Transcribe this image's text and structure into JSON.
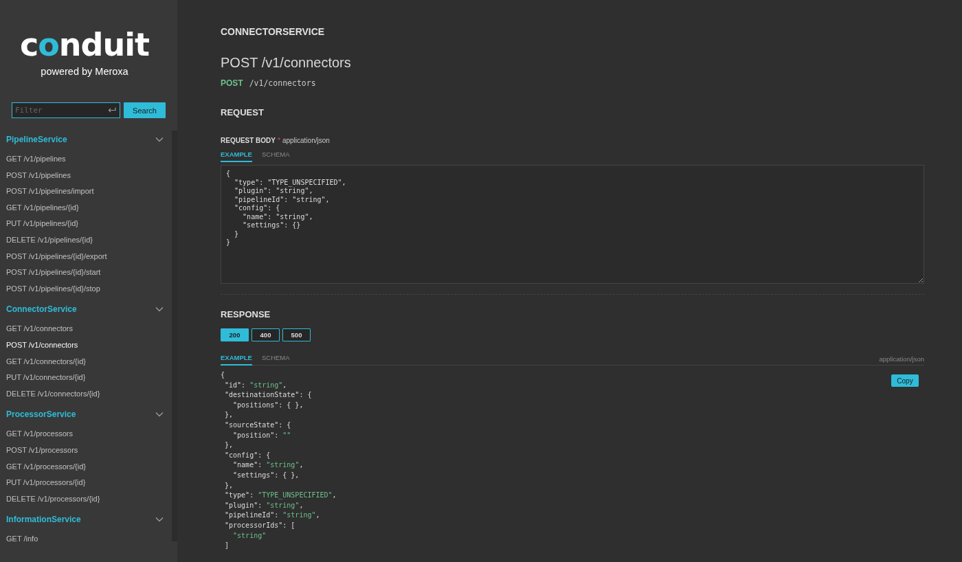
{
  "sidebar": {
    "logo": "conduit",
    "tagline": "powered by Meroxa",
    "filter": {
      "placeholder": "Filter"
    },
    "search_button": "Search",
    "groups": [
      {
        "title": "PipelineService",
        "expanded": true,
        "items": [
          {
            "label": "GET /v1/pipelines",
            "selected": false
          },
          {
            "label": "POST /v1/pipelines",
            "selected": false
          },
          {
            "label": "POST /v1/pipelines/import",
            "selected": false
          },
          {
            "label": "GET /v1/pipelines/{id}",
            "selected": false
          },
          {
            "label": "PUT /v1/pipelines/{id}",
            "selected": false
          },
          {
            "label": "DELETE /v1/pipelines/{id}",
            "selected": false
          },
          {
            "label": "POST /v1/pipelines/{id}/export",
            "selected": false
          },
          {
            "label": "POST /v1/pipelines/{id}/start",
            "selected": false
          },
          {
            "label": "POST /v1/pipelines/{id}/stop",
            "selected": false
          }
        ]
      },
      {
        "title": "ConnectorService",
        "expanded": true,
        "items": [
          {
            "label": "GET /v1/connectors",
            "selected": false
          },
          {
            "label": "POST /v1/connectors",
            "selected": true
          },
          {
            "label": "GET /v1/connectors/{id}",
            "selected": false
          },
          {
            "label": "PUT /v1/connectors/{id}",
            "selected": false
          },
          {
            "label": "DELETE /v1/connectors/{id}",
            "selected": false
          }
        ]
      },
      {
        "title": "ProcessorService",
        "expanded": true,
        "items": [
          {
            "label": "GET /v1/processors",
            "selected": false
          },
          {
            "label": "POST /v1/processors",
            "selected": false
          },
          {
            "label": "GET /v1/processors/{id}",
            "selected": false
          },
          {
            "label": "PUT /v1/processors/{id}",
            "selected": false
          },
          {
            "label": "DELETE /v1/processors/{id}",
            "selected": false
          }
        ]
      },
      {
        "title": "InformationService",
        "expanded": true,
        "items": [
          {
            "label": "GET /info",
            "selected": false
          }
        ]
      }
    ]
  },
  "main": {
    "service": "CONNECTORSERVICE",
    "title": "POST /v1/connectors",
    "method": "POST",
    "path": "/v1/connectors",
    "request": {
      "heading": "REQUEST",
      "body_label": "REQUEST BODY",
      "required_mark": "*",
      "content_type": "application/json",
      "tabs": [
        {
          "label": "EXAMPLE",
          "selected": true
        },
        {
          "label": "SCHEMA",
          "selected": false
        }
      ],
      "body": "{\n  \"type\": \"TYPE_UNSPECIFIED\",\n  \"plugin\": \"string\",\n  \"pipelineId\": \"string\",\n  \"config\": {\n    \"name\": \"string\",\n    \"settings\": {}\n  }\n}"
    },
    "response": {
      "heading": "RESPONSE",
      "codes": [
        {
          "label": "200",
          "selected": true
        },
        {
          "label": "400",
          "selected": false
        },
        {
          "label": "500",
          "selected": false
        }
      ],
      "tabs": [
        {
          "label": "EXAMPLE",
          "selected": true
        },
        {
          "label": "SCHEMA",
          "selected": false
        }
      ],
      "content_type": "application/json",
      "copy_button": "Copy",
      "lines": [
        {
          "code": "{"
        },
        {
          "code": " \"id\": ",
          "string": "\"string\"",
          "end": ","
        },
        {
          "code": " \"destinationState\": {"
        },
        {
          "code": "   \"positions\": { },"
        },
        {
          "code": " },"
        },
        {
          "code": " \"sourceState\": {"
        },
        {
          "code": "   \"position\": ",
          "string": "\"\""
        },
        {
          "code": " },"
        },
        {
          "code": " \"config\": {"
        },
        {
          "code": "   \"name\": ",
          "string": "\"string\"",
          "end": ","
        },
        {
          "code": "   \"settings\": { },"
        },
        {
          "code": " },"
        },
        {
          "code": " \"type\": ",
          "string": "\"TYPE_UNSPECIFIED\"",
          "end": ","
        },
        {
          "code": " \"plugin\": ",
          "string": "\"string\"",
          "end": ","
        },
        {
          "code": " \"pipelineId\": ",
          "string": "\"string\"",
          "end": ","
        },
        {
          "code": " \"processorIds\": ["
        },
        {
          "string": "   \"string\""
        },
        {
          "code": " ]"
        }
      ]
    }
  }
}
